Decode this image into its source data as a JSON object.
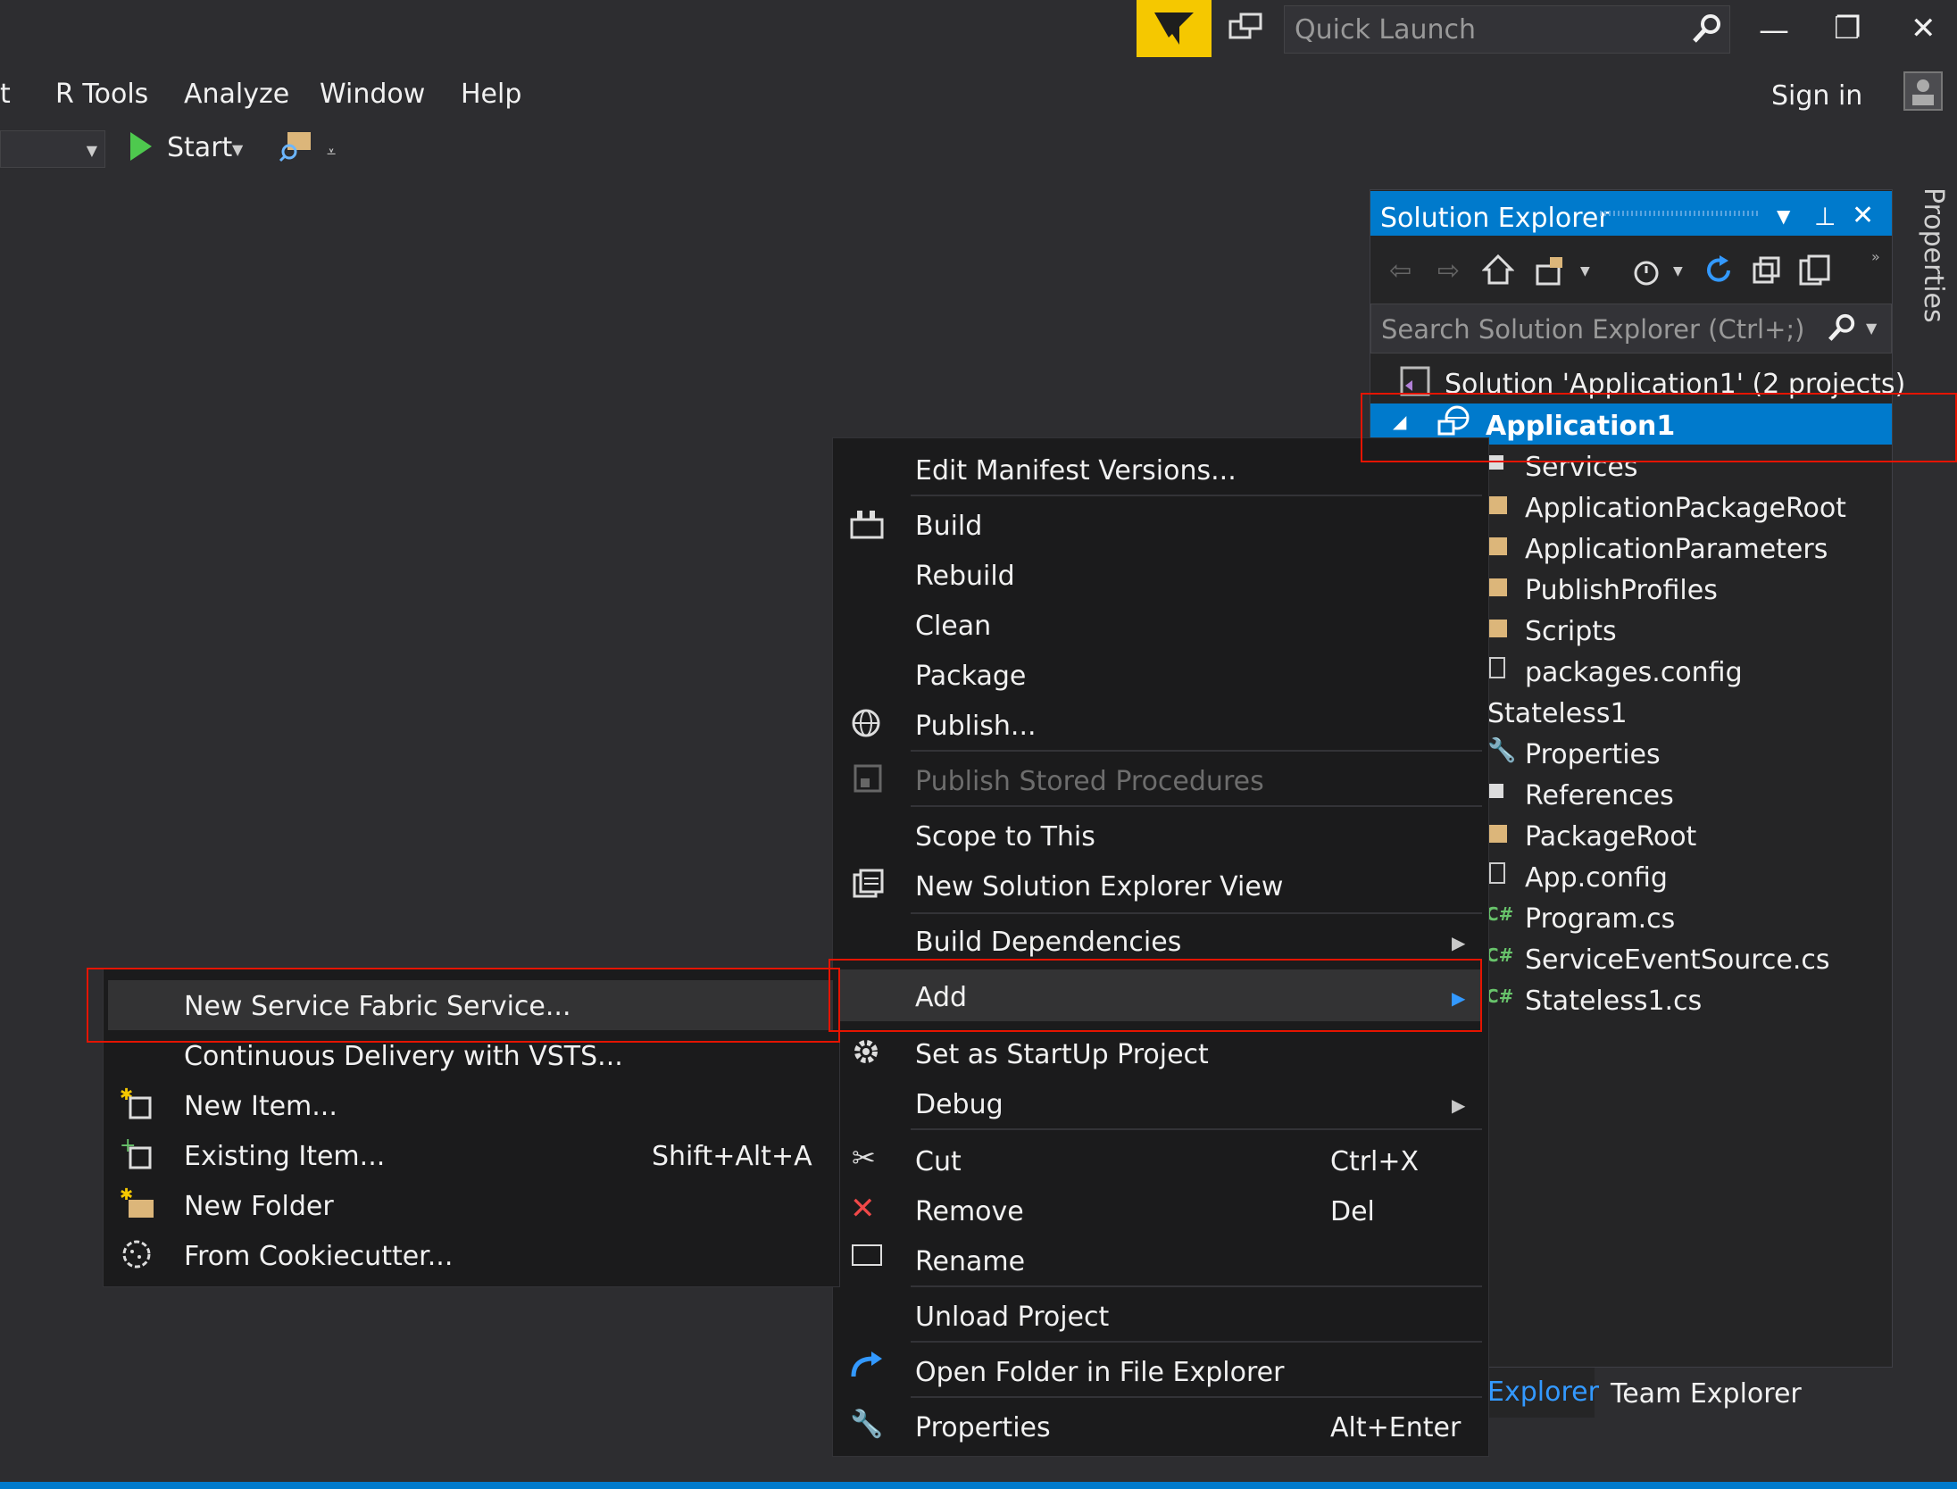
{
  "titlebar": {
    "quick_launch_placeholder": "Quick Launch",
    "minimize_glyph": "—",
    "restore_glyph": "❐",
    "close_glyph": "✕"
  },
  "menubar": {
    "items": [
      "t",
      "R Tools",
      "Analyze",
      "Window",
      "Help"
    ],
    "sign_in": "Sign in"
  },
  "toolbar": {
    "start_label": "Start"
  },
  "right_rail": {
    "properties_tab": "Properties"
  },
  "solution_explorer": {
    "title": "Solution Explorer",
    "search_placeholder": "Search Solution Explorer (Ctrl+;)",
    "tree": [
      {
        "label": "Solution 'Application1' (2 projects)",
        "icon": "solution-icon"
      },
      {
        "label": "Application1",
        "icon": "service-fabric-app-icon",
        "selected": true
      },
      {
        "label": "Services",
        "icon": "references-icon"
      },
      {
        "label": "ApplicationPackageRoot",
        "icon": "folder-icon"
      },
      {
        "label": "ApplicationParameters",
        "icon": "folder-icon"
      },
      {
        "label": "PublishProfiles",
        "icon": "folder-icon"
      },
      {
        "label": "Scripts",
        "icon": "folder-icon"
      },
      {
        "label": "packages.config",
        "icon": "file-icon"
      },
      {
        "label": "Stateless1",
        "icon": ""
      },
      {
        "label": "Properties",
        "icon": "wrench-icon"
      },
      {
        "label": "References",
        "icon": "references-icon"
      },
      {
        "label": "PackageRoot",
        "icon": "folder-icon"
      },
      {
        "label": "App.config",
        "icon": "file-icon"
      },
      {
        "label": "Program.cs",
        "icon": "csharp-icon"
      },
      {
        "label": "ServiceEventSource.cs",
        "icon": "csharp-icon"
      },
      {
        "label": "Stateless1.cs",
        "icon": "csharp-icon"
      }
    ],
    "bottom_tabs": [
      "Explorer",
      "Team Explorer"
    ]
  },
  "context_menu": {
    "items": [
      {
        "label": "Edit Manifest Versions...",
        "icon": ""
      },
      {
        "label": "Build",
        "icon": "build-icon"
      },
      {
        "label": "Rebuild",
        "icon": ""
      },
      {
        "label": "Clean",
        "icon": ""
      },
      {
        "label": "Package",
        "icon": ""
      },
      {
        "label": "Publish...",
        "icon": "globe-icon"
      },
      {
        "label": "Publish Stored Procedures",
        "icon": "publish-sp-icon",
        "disabled": true
      },
      {
        "label": "Scope to This",
        "icon": ""
      },
      {
        "label": "New Solution Explorer View",
        "icon": "new-view-icon"
      },
      {
        "label": "Build Dependencies",
        "icon": "",
        "submenu": true
      },
      {
        "label": "Add",
        "icon": "",
        "submenu": true,
        "highlighted": true
      },
      {
        "label": "Set as StartUp Project",
        "icon": "gear-icon"
      },
      {
        "label": "Debug",
        "icon": "",
        "submenu": true
      },
      {
        "label": "Cut",
        "icon": "scissors-icon",
        "shortcut": "Ctrl+X"
      },
      {
        "label": "Remove",
        "icon": "remove-icon",
        "shortcut": "Del"
      },
      {
        "label": "Rename",
        "icon": "rename-icon"
      },
      {
        "label": "Unload Project",
        "icon": ""
      },
      {
        "label": "Open Folder in File Explorer",
        "icon": "open-folder-icon"
      },
      {
        "label": "Properties",
        "icon": "wrench-icon",
        "shortcut": "Alt+Enter"
      }
    ]
  },
  "add_submenu": {
    "items": [
      {
        "label": "New Service Fabric Service...",
        "icon": "",
        "highlighted": true
      },
      {
        "label": "Continuous Delivery with VSTS...",
        "icon": ""
      },
      {
        "label": "New Item...",
        "icon": "new-item-icon"
      },
      {
        "label": "Existing Item...",
        "icon": "existing-item-icon",
        "shortcut": "Shift+Alt+A"
      },
      {
        "label": "New Folder",
        "icon": "new-folder-icon"
      },
      {
        "label": "From Cookiecutter...",
        "icon": "cookiecutter-icon"
      }
    ]
  },
  "colors": {
    "background": "#2d2d30",
    "accent": "#007acc",
    "menu_bg": "#1b1b1c",
    "highlight_box": "#e51400",
    "feedback_yellow": "#f5c800"
  }
}
